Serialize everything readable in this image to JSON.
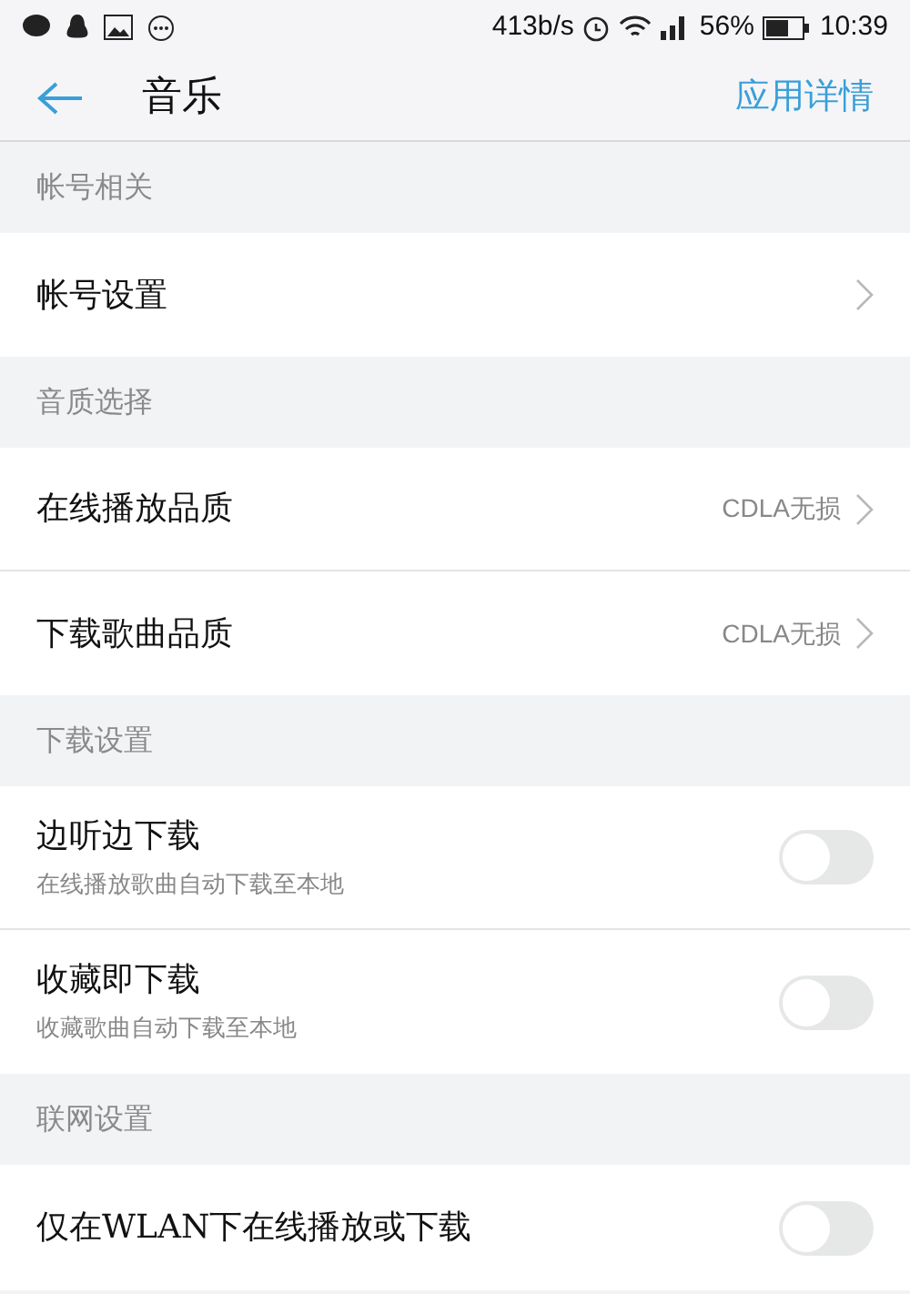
{
  "status_bar": {
    "speed": "413b/s",
    "battery": "56%",
    "time": "10:39"
  },
  "header": {
    "title": "音乐",
    "action": "应用详情"
  },
  "sections": [
    {
      "title": "帐号相关",
      "rows": [
        {
          "kind": "nav",
          "label": "帐号设置"
        }
      ]
    },
    {
      "title": "音质选择",
      "rows": [
        {
          "kind": "nav",
          "label": "在线播放品质",
          "value": "CDLA无损"
        },
        {
          "kind": "nav",
          "label": "下载歌曲品质",
          "value": "CDLA无损"
        }
      ]
    },
    {
      "title": "下载设置",
      "rows": [
        {
          "kind": "toggle",
          "label": "边听边下载",
          "subtitle": "在线播放歌曲自动下载至本地",
          "on": false
        },
        {
          "kind": "toggle",
          "label": "收藏即下载",
          "subtitle": "收藏歌曲自动下载至本地",
          "on": false
        }
      ]
    },
    {
      "title": "联网设置",
      "rows": [
        {
          "kind": "toggle",
          "label": "仅在WLAN下在线播放或下载",
          "on": false
        }
      ]
    }
  ]
}
